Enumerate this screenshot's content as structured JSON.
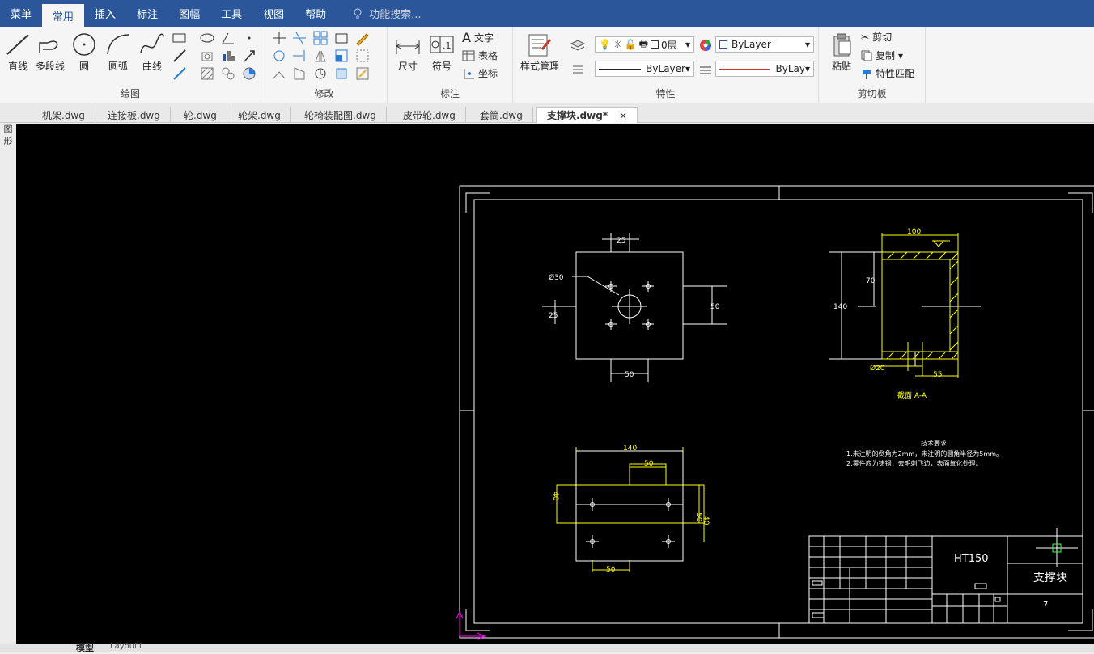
{
  "menubar": {
    "items": [
      "菜单",
      "常用",
      "插入",
      "标注",
      "图幅",
      "工具",
      "视图",
      "帮助"
    ],
    "active": "常用",
    "search_placeholder": "功能搜索..."
  },
  "ribbon": {
    "draw": {
      "title": "绘图",
      "line": "直线",
      "polyline": "多段线",
      "circle": "圆",
      "arc": "圆弧",
      "curve": "曲线"
    },
    "modify": {
      "title": "修改"
    },
    "annotate": {
      "title": "标注",
      "dimension": "尺寸",
      "symbol": "符号",
      "text": "文字",
      "table": "表格",
      "coord": "坐标"
    },
    "props": {
      "title": "特性",
      "style": "样式管理",
      "layer": "0层",
      "color": "ByLayer",
      "linetype": "ByLayer",
      "lineweight": "ByLay"
    },
    "clipboard": {
      "title": "剪切板",
      "paste": "粘贴",
      "cut": "剪切",
      "copy": "复制",
      "match": "特性匹配"
    }
  },
  "tabs": [
    "机架.dwg",
    "连接板.dwg",
    "轮.dwg",
    "轮架.dwg",
    "轮椅装配图.dwg",
    "皮带轮.dwg",
    "套筒.dwg",
    "支撑块.dwg*"
  ],
  "active_tab": "支撑块.dwg*",
  "left_tools": [
    "图",
    "形"
  ],
  "layout_tabs": [
    "模型",
    "Layout1"
  ],
  "drawing": {
    "top_view": {
      "dim_top": "25",
      "dim_dia": "Ø30",
      "dim_left": "25",
      "dim_right": "50",
      "dim_bottom": "50"
    },
    "section_view": {
      "dim_top": "100",
      "dim_70": "70",
      "dim_140": "140",
      "dim_dia": "Ø20",
      "dim_55": "55",
      "caption": "截面 A-A"
    },
    "front_view": {
      "dim_top": "140",
      "dim_50": "50",
      "dim_bottom": "50",
      "dim_right": "50",
      "dim_40": "40",
      "dim_left": "40"
    },
    "notes": {
      "title": "技术要求",
      "line1": "1.未注明的倒角为2mm，未注明的圆角半径为5mm。",
      "line2": "2.零件应为铸钢，去毛刺飞边，表面氧化处理。"
    },
    "title_block": {
      "material": "HT150",
      "part_name": "支撑块",
      "number": "7"
    }
  },
  "colors": {
    "brand": "#2b579a",
    "cad_white": "#ffffff",
    "cad_yellow": "#ffff00",
    "cad_magenta": "#ff00ff"
  }
}
